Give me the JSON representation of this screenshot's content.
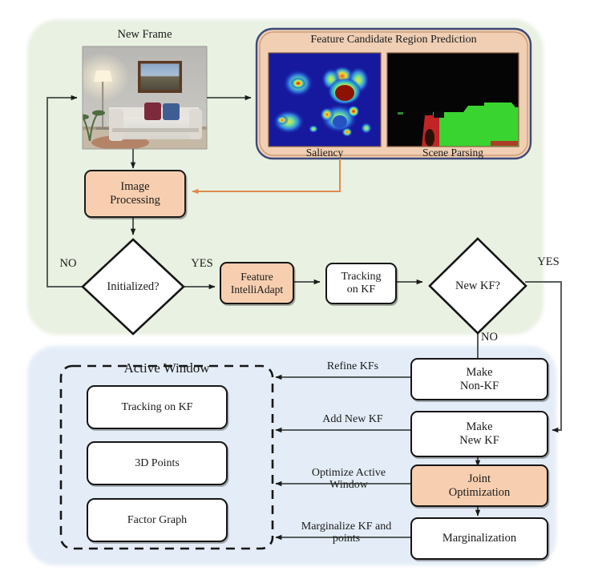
{
  "meta": {
    "figure_type": "flowchart",
    "colors": {
      "green_panel": "#e9f1e2",
      "blue_panel": "#e4edf7",
      "peach_fill": "#f7cfb0",
      "peach_border": "#c1855c",
      "panel_border_blue": "#3c4a7a",
      "orange_arrow": "#e08a4e",
      "box_border": "#151515",
      "line": "#555c5a"
    }
  },
  "top": {
    "new_frame_label": "New Frame",
    "prediction_panel": {
      "title": "Feature Candidate Region Prediction",
      "left_caption": "Saliency",
      "right_caption": "Scene Parsing"
    }
  },
  "nodes": {
    "image_processing": {
      "line1": "Image",
      "line2": "Processing"
    },
    "initialized": {
      "label": "Initialized?"
    },
    "feature_intelliadapt": {
      "line1": "Feature",
      "line2": "IntelliAdapt"
    },
    "tracking_on_kf": {
      "line1": "Tracking",
      "line2": "on KF"
    },
    "new_kf": {
      "label": "New KF?"
    },
    "make_non_kf": {
      "line1": "Make",
      "line2": "Non-KF"
    },
    "make_new_kf": {
      "line1": "Make",
      "line2": "New KF"
    },
    "joint_optimization": {
      "line1": "Joint",
      "line2": "Optimization"
    },
    "marginalization": {
      "label": "Marginalization"
    }
  },
  "active_window": {
    "title": "Active Window",
    "items": [
      {
        "label": "Tracking on KF"
      },
      {
        "label": "3D Points"
      },
      {
        "label": "Factor Graph"
      }
    ]
  },
  "edge_labels": {
    "initialized_no": "NO",
    "initialized_yes": "YES",
    "newkf_yes": "YES",
    "newkf_no": "NO",
    "refine_kfs": "Refine KFs",
    "add_new_kf": "Add New KF",
    "optimize_active_window_l1": "Optimize Active",
    "optimize_active_window_l2": "Window",
    "marginalize_l1": "Marginalize KF and",
    "marginalize_l2": "points"
  }
}
